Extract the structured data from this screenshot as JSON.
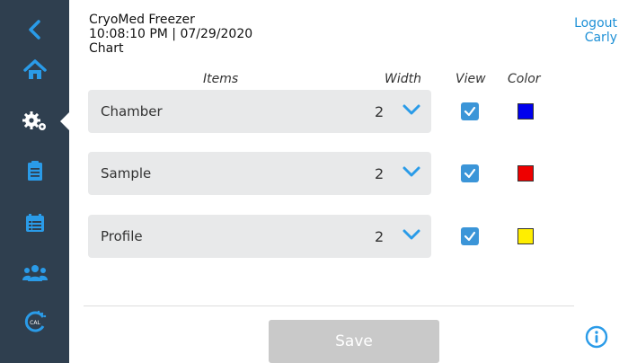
{
  "header": {
    "device_name": "CryoMed Freezer",
    "datetime": "10:08:10 PM | 07/29/2020",
    "page_title": "Chart"
  },
  "account": {
    "logout_label": "Logout",
    "user_name": "Carly"
  },
  "sidebar": {
    "items": [
      {
        "icon": "back-chevron-icon"
      },
      {
        "icon": "home-icon"
      },
      {
        "icon": "gears-icon",
        "active": true
      },
      {
        "icon": "clipboard-icon"
      },
      {
        "icon": "calendar-list-icon"
      },
      {
        "icon": "users-icon"
      },
      {
        "icon": "calibration-icon",
        "label": "CAL"
      }
    ]
  },
  "columns": {
    "items": "Items",
    "width": "Width",
    "view": "View",
    "color": "Color"
  },
  "rows": [
    {
      "label": "Chamber",
      "width": "2",
      "view": true,
      "color": "#0000ee"
    },
    {
      "label": "Sample",
      "width": "2",
      "view": true,
      "color": "#ee0000"
    },
    {
      "label": "Profile",
      "width": "2",
      "view": true,
      "color": "#ffee00"
    }
  ],
  "actions": {
    "save_label": "Save"
  },
  "colors": {
    "sidebar_bg": "#2f3f4f",
    "accent": "#3b95d8",
    "row_bg": "#e8e9ea",
    "save_disabled": "#c9c9c9"
  }
}
